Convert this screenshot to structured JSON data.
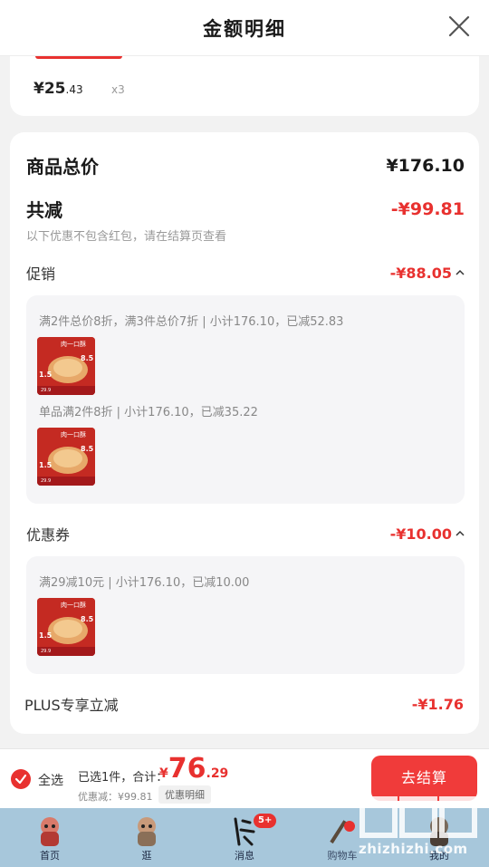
{
  "header": {
    "title": "金额明细"
  },
  "top_item": {
    "price_int": "¥25",
    "price_dec": ".43",
    "qty": "x3"
  },
  "summary": {
    "total_label": "商品总价",
    "total_value": "¥176.10",
    "discount_label": "共减",
    "discount_value": "-¥99.81",
    "note": "以下优惠不包含红包，请在结算页查看"
  },
  "promo": {
    "label": "促销",
    "value": "-¥88.05",
    "rules": [
      "满2件总价8折，满3件总价7折 | 小计176.10，已减52.83",
      "单品满2件8折 | 小计176.10，已减35.22"
    ]
  },
  "coupon": {
    "label": "优惠券",
    "value": "-¥10.00",
    "rules": [
      "满29减10元 | 小计176.10，已减10.00"
    ]
  },
  "plus": {
    "label": "PLUS专享立减",
    "value": "-¥1.76"
  },
  "product_thumb": {
    "headline": "肉一口酥",
    "price_a": "8.5",
    "price_b": "1.5",
    "price_c": "29.9"
  },
  "footer": {
    "select_all": "全选",
    "picked": "已选1件，合计：",
    "total_cur": "¥",
    "total_int": "76",
    "total_dec": ".29",
    "saved": "优惠减：¥99.81",
    "detail_button": "优惠明细",
    "checkout_button": "去结算"
  },
  "tabbar": {
    "tabs": [
      {
        "label": "首页"
      },
      {
        "label": "逛"
      },
      {
        "label": "消息",
        "badge": "5+"
      },
      {
        "label": "购物车"
      },
      {
        "label": "我的"
      }
    ]
  },
  "watermark": {
    "text": "zhizhizhi.com"
  },
  "colors": {
    "accent": "#e8312f",
    "tabbar": "#a7c7db"
  }
}
